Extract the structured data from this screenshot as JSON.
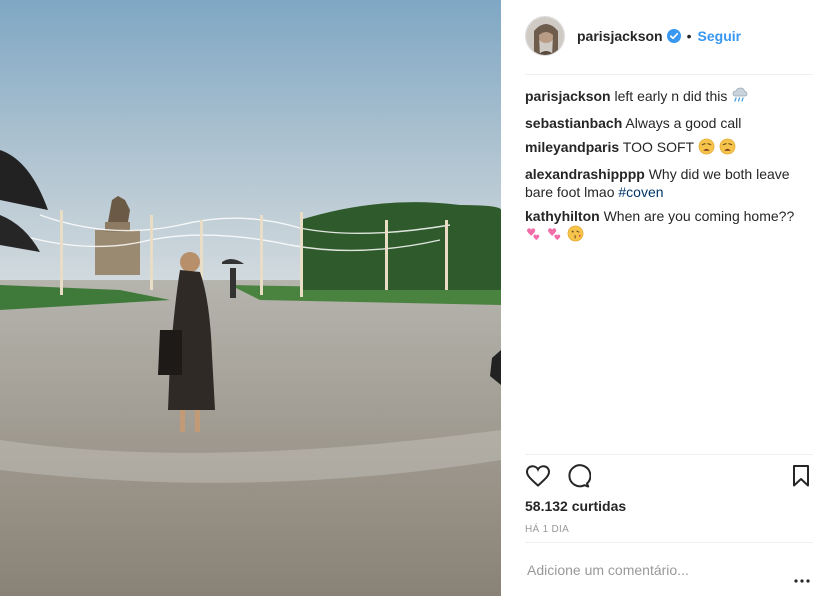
{
  "post": {
    "author": "parisjackson",
    "separator": "•",
    "follow_label": "Seguir",
    "likes": "58.132 curtidas",
    "time": "HÁ 1 DIA",
    "add_comment_placeholder": "Adicione um comentário..."
  },
  "comments": [
    {
      "user": "parisjackson",
      "text": "left early n did this",
      "emoji": [
        "cloud-rain-icon"
      ]
    },
    {
      "user": "sebastianbach",
      "text": "Always a good call",
      "emoji": []
    },
    {
      "user": "mileyandparis",
      "text": "TOO SOFT",
      "emoji": [
        "weary-face-icon",
        "weary-face-icon"
      ]
    },
    {
      "user": "alexandrashipppp",
      "text": "Why did we both leave bare foot lmao",
      "hashtag": "#coven",
      "emoji": []
    },
    {
      "user": "kathyhilton",
      "text": "When are you coming home??",
      "emoji": [
        "two-hearts-icon",
        "two-hearts-icon",
        "kissing-face-icon"
      ]
    }
  ],
  "icons": {
    "like": "heart-icon",
    "comment": "comment-bubble-icon",
    "save": "bookmark-icon",
    "more": "more-options-icon",
    "verified": "verified-badge-icon"
  },
  "colors": {
    "link_blue": "#3897f0",
    "hashtag": "#003569",
    "muted": "#999999"
  }
}
